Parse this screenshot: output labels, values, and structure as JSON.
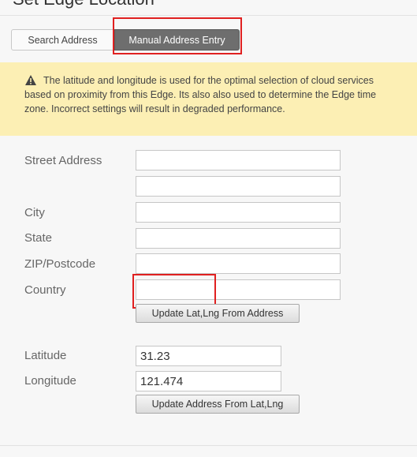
{
  "dialog": {
    "title": "Set Edge Location"
  },
  "tabs": [
    {
      "label": "Search Address",
      "active": false
    },
    {
      "label": "Manual Address Entry",
      "active": true
    }
  ],
  "warning": {
    "icon": "warning-triangle-icon",
    "text": "The latitude and longitude is used for the optimal selection of cloud services based on proximity from this Edge. Its also also used to determine the Edge time zone. Incorrect settings will result in degraded performance."
  },
  "form": {
    "street_label": "Street Address",
    "street_line1": "",
    "street_line2": "",
    "city_label": "City",
    "city": "",
    "state_label": "State",
    "state": "",
    "zip_label": "ZIP/Postcode",
    "zip": "",
    "country_label": "Country",
    "country": "",
    "update_latlng_button": "Update Lat,Lng From Address",
    "latitude_label": "Latitude",
    "latitude": "31.23",
    "longitude_label": "Longitude",
    "longitude": "121.474",
    "update_address_button": "Update Address From Lat,Lng"
  },
  "colors": {
    "accent_highlight": "#e02020",
    "banner_bg": "#fcefb4",
    "active_tab_bg": "#6e6e6e"
  }
}
